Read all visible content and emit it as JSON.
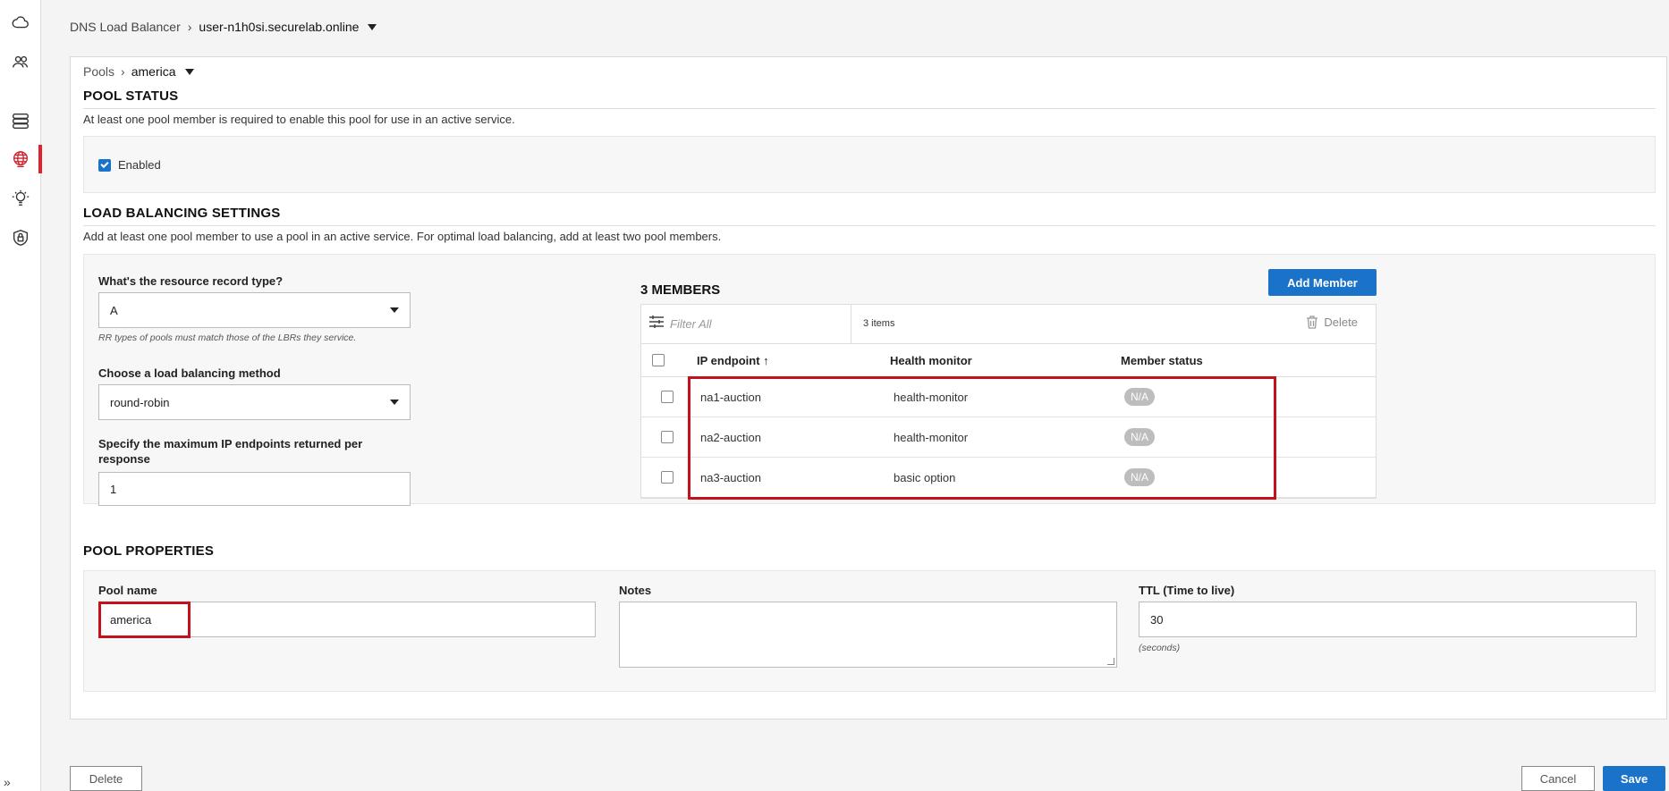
{
  "breadcrumb_top": {
    "root": "DNS Load Balancer",
    "current": "user-n1h0si.securelab.online"
  },
  "breadcrumb_panel": {
    "root": "Pools",
    "current": "america"
  },
  "pool_status": {
    "title": "POOL STATUS",
    "description": "At least one pool member is required to enable this pool for use in an active service.",
    "enabled_label": "Enabled",
    "enabled": true
  },
  "lb_settings": {
    "title": "LOAD BALANCING SETTINGS",
    "description": "Add at least one pool member to use a pool in an active service. For optimal load balancing, add at least two pool members.",
    "rr_type_label": "What's the resource record type?",
    "rr_type_value": "A",
    "rr_type_helper": "RR types of pools must match those of the LBRs they service.",
    "method_label": "Choose a load balancing method",
    "method_value": "round-robin",
    "max_ip_label": "Specify the maximum IP endpoints returned per response",
    "max_ip_value": "1"
  },
  "members": {
    "title": "3 MEMBERS",
    "add_button": "Add Member",
    "filter_placeholder": "Filter All",
    "count": "3 items",
    "delete_label": "Delete",
    "columns": [
      "IP endpoint ↑",
      "Health monitor",
      "Member status"
    ],
    "rows": [
      {
        "endpoint": "na1-auction",
        "monitor": "health-monitor",
        "status": "N/A"
      },
      {
        "endpoint": "na2-auction",
        "monitor": "health-monitor",
        "status": "N/A"
      },
      {
        "endpoint": "na3-auction",
        "monitor": "basic option",
        "status": "N/A"
      }
    ]
  },
  "pool_properties": {
    "title": "POOL PROPERTIES",
    "name_label": "Pool name",
    "name_value": "america",
    "notes_label": "Notes",
    "ttl_label": "TTL (Time to live)",
    "ttl_value": "30",
    "ttl_helper": "(seconds)"
  },
  "footer": {
    "delete": "Delete",
    "cancel": "Cancel",
    "save": "Save"
  },
  "sidebar_icons": [
    "cloud-icon",
    "users-icon",
    "server-icon",
    "globe-icon",
    "lightbulb-gear-icon",
    "shield-lock-icon"
  ],
  "colors": {
    "primary": "#1a73c9",
    "accent_red": "#e0222f",
    "highlight": "#c4121d"
  }
}
